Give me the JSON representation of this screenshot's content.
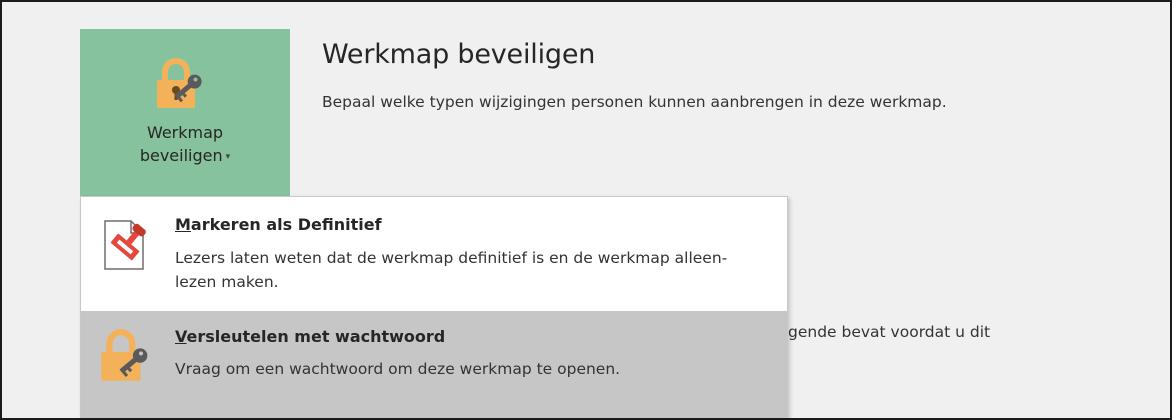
{
  "protect_button": {
    "line1": "Werkmap",
    "line2": "beveiligen",
    "caret": "▾",
    "icon": "lock-key-icon",
    "color": "#86c29d"
  },
  "section": {
    "title": "Werkmap beveiligen",
    "description": "Bepaal welke typen wijzigingen personen kunnen aanbrengen in deze werkmap."
  },
  "background_text": "gende bevat voordat u dit",
  "menu": {
    "items": [
      {
        "mnemonic": "M",
        "title_rest": "arkeren als Definitief",
        "description": "Lezers laten weten dat de werkmap definitief is en de werkmap alleen-lezen maken.",
        "icon": "mark-final-stamp-icon",
        "highlighted": false
      },
      {
        "mnemonic": "V",
        "title_rest": "ersleutelen met wachtwoord",
        "description": "Vraag om een wachtwoord om deze werkmap te openen.",
        "icon": "lock-key-icon",
        "highlighted": true
      }
    ]
  },
  "colors": {
    "accent_green": "#86c29d",
    "lock_orange": "#f3b25a",
    "hover_gray": "#c6c6c6"
  }
}
